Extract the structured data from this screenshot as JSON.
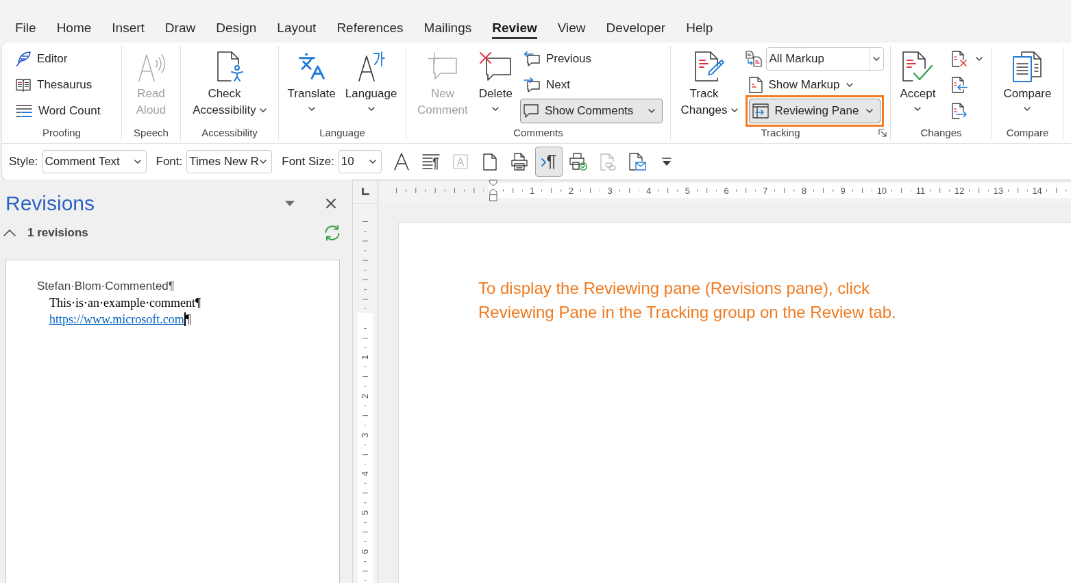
{
  "tabs": [
    {
      "label": "File",
      "selected": false
    },
    {
      "label": "Home",
      "selected": false
    },
    {
      "label": "Insert",
      "selected": false
    },
    {
      "label": "Draw",
      "selected": false
    },
    {
      "label": "Design",
      "selected": false
    },
    {
      "label": "Layout",
      "selected": false
    },
    {
      "label": "References",
      "selected": false
    },
    {
      "label": "Mailings",
      "selected": false
    },
    {
      "label": "Review",
      "selected": true
    },
    {
      "label": "View",
      "selected": false
    },
    {
      "label": "Developer",
      "selected": false
    },
    {
      "label": "Help",
      "selected": false
    }
  ],
  "ribbon_groups": [
    {
      "label": "Proofing",
      "dialog_launcher": false,
      "items": [
        {
          "kind": "small",
          "label": "Editor",
          "menu": false,
          "disabled": false,
          "pressed": false,
          "highlighted": false
        },
        {
          "kind": "small",
          "label": "Thesaurus",
          "menu": false,
          "disabled": false,
          "pressed": false,
          "highlighted": false
        },
        {
          "kind": "small",
          "label": "Word Count",
          "menu": false,
          "disabled": false,
          "pressed": false,
          "highlighted": false
        }
      ]
    },
    {
      "label": "Speech",
      "dialog_launcher": false,
      "items": [
        {
          "kind": "large",
          "label": "Read Aloud",
          "menu": false,
          "disabled": true,
          "pressed": false,
          "highlighted": false
        }
      ]
    },
    {
      "label": "Accessibility",
      "dialog_launcher": false,
      "items": [
        {
          "kind": "large",
          "label": "Check Accessibility",
          "menu": true,
          "disabled": false,
          "pressed": false,
          "highlighted": false
        }
      ]
    },
    {
      "label": "Language",
      "dialog_launcher": false,
      "items": [
        {
          "kind": "large",
          "label": "Translate",
          "menu": true,
          "disabled": false,
          "pressed": false,
          "highlighted": false
        },
        {
          "kind": "large",
          "label": "Language",
          "menu": true,
          "disabled": false,
          "pressed": false,
          "highlighted": false
        }
      ]
    },
    {
      "label": "Comments",
      "dialog_launcher": false,
      "items": [
        {
          "kind": "large",
          "label": "New Comment",
          "menu": false,
          "disabled": true,
          "pressed": false,
          "highlighted": false
        },
        {
          "kind": "large",
          "label": "Delete",
          "menu": true,
          "disabled": false,
          "pressed": false,
          "highlighted": false
        },
        {
          "kind": "small",
          "label": "Previous",
          "menu": false,
          "disabled": false,
          "pressed": false,
          "highlighted": false
        },
        {
          "kind": "small",
          "label": "Next",
          "menu": false,
          "disabled": false,
          "pressed": false,
          "highlighted": false
        },
        {
          "kind": "small",
          "label": "Show Comments",
          "menu": true,
          "disabled": false,
          "pressed": true,
          "highlighted": false
        }
      ]
    },
    {
      "label": "Tracking",
      "dialog_launcher": true,
      "items": [
        {
          "kind": "large",
          "label": "Track Changes",
          "menu": true,
          "disabled": false,
          "pressed": false,
          "highlighted": false
        },
        {
          "kind": "select",
          "value": "All Markup",
          "menu": true,
          "disabled": false,
          "pressed": false,
          "highlighted": false
        },
        {
          "kind": "small",
          "label": "Show Markup",
          "menu": true,
          "disabled": false,
          "pressed": false,
          "highlighted": false
        },
        {
          "kind": "small",
          "label": "Reviewing Pane",
          "menu": true,
          "disabled": false,
          "pressed": true,
          "highlighted": true
        }
      ]
    },
    {
      "label": "Changes",
      "dialog_launcher": false,
      "items": [
        {
          "kind": "large",
          "label": "Accept",
          "menu": true,
          "disabled": false,
          "pressed": false,
          "highlighted": false
        },
        {
          "kind": "icon",
          "menu": true,
          "disabled": false,
          "pressed": false,
          "highlighted": false
        },
        {
          "kind": "icon",
          "menu": false,
          "disabled": false,
          "pressed": false,
          "highlighted": false
        },
        {
          "kind": "icon",
          "menu": false,
          "disabled": false,
          "pressed": false,
          "highlighted": false
        }
      ]
    },
    {
      "label": "Compare",
      "dialog_launcher": false,
      "items": [
        {
          "kind": "large",
          "label": "Compare",
          "menu": true,
          "disabled": false,
          "pressed": false,
          "highlighted": false
        }
      ]
    }
  ],
  "toolbar": {
    "fields": [
      {
        "label": "Style:",
        "value": "Comment Text"
      },
      {
        "label": "Font:",
        "value": "Times New R"
      },
      {
        "label": "Font Size:",
        "value": "10"
      }
    ],
    "buttons": [
      {
        "pressed": false,
        "disabled": false
      },
      {
        "pressed": false,
        "disabled": false
      },
      {
        "pressed": false,
        "disabled": true
      },
      {
        "pressed": false,
        "disabled": false
      },
      {
        "pressed": false,
        "disabled": false
      },
      {
        "pressed": true,
        "disabled": false
      },
      {
        "pressed": false,
        "disabled": false
      },
      {
        "pressed": false,
        "disabled": true
      },
      {
        "pressed": false,
        "disabled": false
      },
      {
        "pressed": false,
        "disabled": false
      }
    ]
  },
  "revisions_pane": {
    "title": "Revisions",
    "summary": {
      "label": "1 revisions",
      "expanded": true
    },
    "entry": {
      "author_line": "Stefan·Blom·Commented¶",
      "comment": "This·is·an·example·comment¶",
      "link": "https://www.microsoft.com",
      "end_mark": "¶"
    }
  },
  "rulers": {
    "horizontal": [
      "1",
      "2",
      "3",
      "4",
      "5",
      "6",
      "7",
      "8",
      "9",
      "10",
      "11",
      "12",
      "13",
      "14"
    ],
    "vertical": [
      "1",
      "2",
      "3",
      "4",
      "5",
      "6"
    ]
  },
  "document": {
    "text": "To display the Reviewing pane (Revisions pane), click\nReviewing Pane in the Tracking group on the Review tab."
  }
}
